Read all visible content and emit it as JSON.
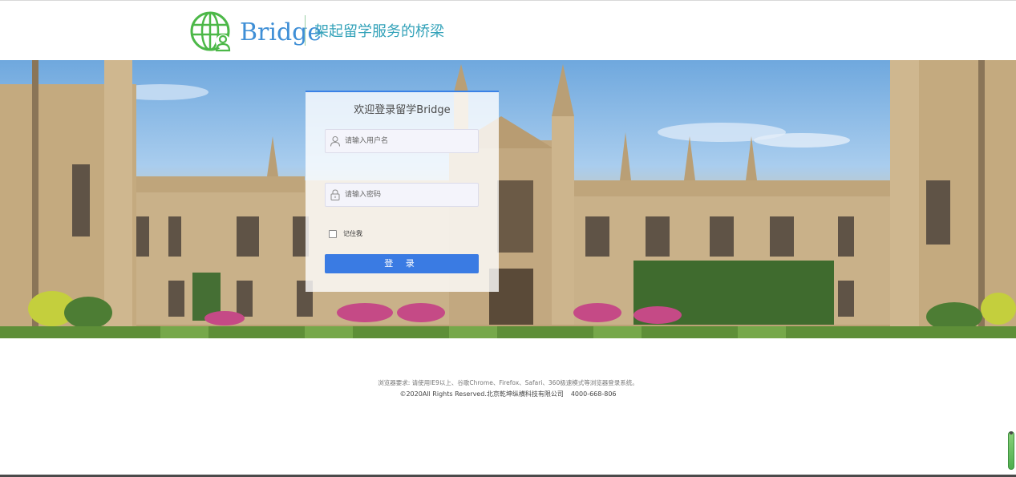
{
  "header": {
    "brand": "Bridge",
    "slogan": "架起留学服务的桥梁"
  },
  "login": {
    "title": "欢迎登录留学Bridge",
    "username_placeholder": "请输入用户名",
    "password_placeholder": "请输入密码",
    "remember_label": "记住我",
    "submit_label": "登 录"
  },
  "footer": {
    "browser_note": "浏览器要求: 请使用IE9以上、谷歌Chrome、Firefox、Safari、360极速模式等浏览器登录系统。",
    "copyright": "©2020All Rights Reserved.北京乾坤纵横科技有限公司",
    "phone": "4000-668-806"
  },
  "colors": {
    "brand_blue": "#3f8fd6",
    "logo_green": "#4cb848",
    "button_blue": "#3a7be3",
    "slogan_teal": "#33a2b9"
  }
}
